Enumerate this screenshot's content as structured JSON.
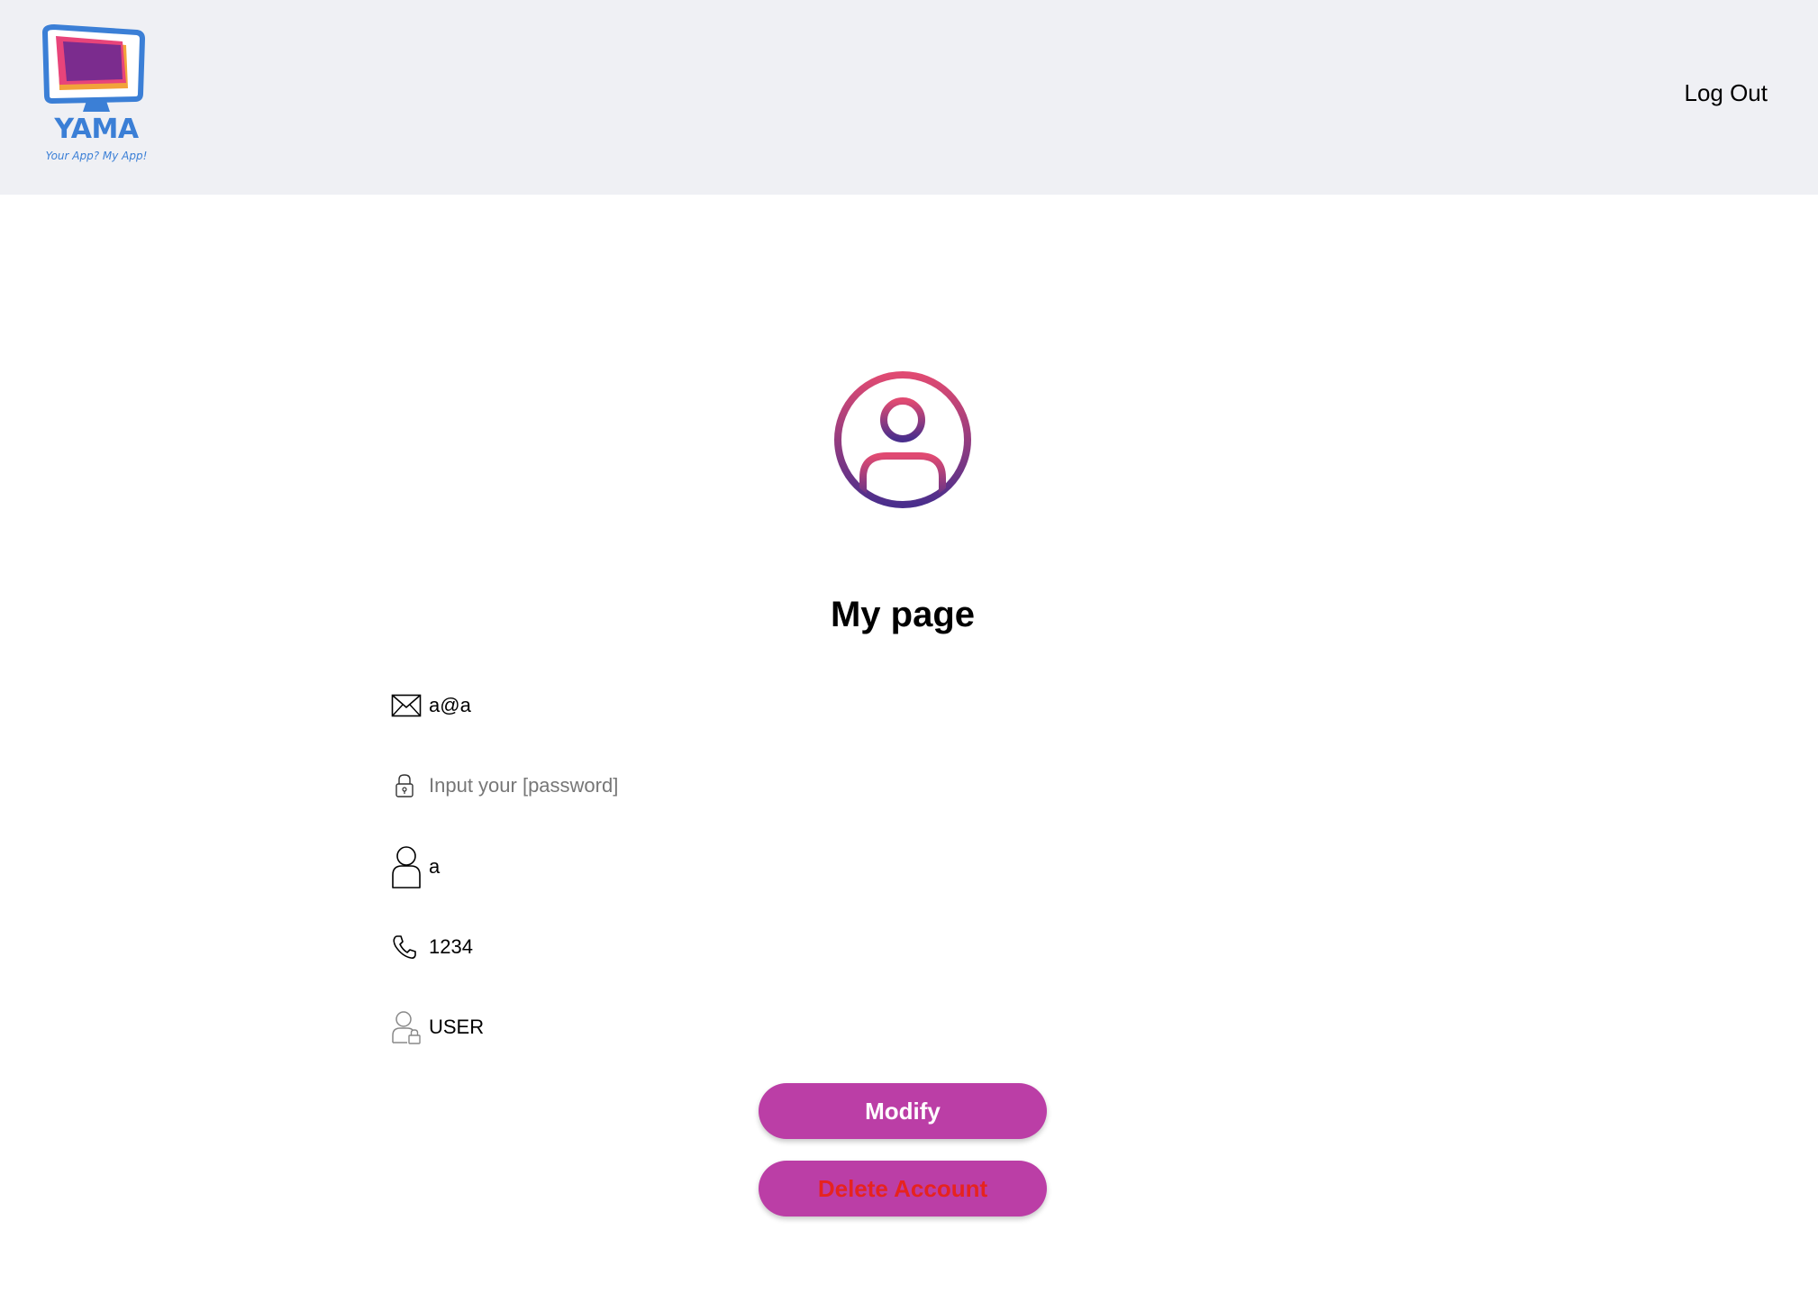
{
  "header": {
    "logo": {
      "name": "YAMA",
      "tagline": "Your App? My App!"
    },
    "logout_label": "Log Out"
  },
  "main": {
    "title": "My page",
    "fields": {
      "email": {
        "value": "a@a",
        "icon": "envelope-icon"
      },
      "password": {
        "value": "",
        "placeholder": "Input your [password]",
        "icon": "lock-icon"
      },
      "name": {
        "value": "a",
        "icon": "person-icon"
      },
      "phone": {
        "value": "1234",
        "icon": "phone-icon"
      },
      "role": {
        "value": "USER",
        "icon": "user-lock-icon"
      }
    },
    "buttons": {
      "modify_label": "Modify",
      "delete_label": "Delete Account"
    }
  },
  "colors": {
    "header_bg": "#eff0f4",
    "brand_blue": "#3b7fd6",
    "button_bg": "#bb3ea6",
    "delete_text": "#e6231f",
    "avatar_gradient_top": "#e04a72",
    "avatar_gradient_bottom": "#4a2e8c"
  }
}
